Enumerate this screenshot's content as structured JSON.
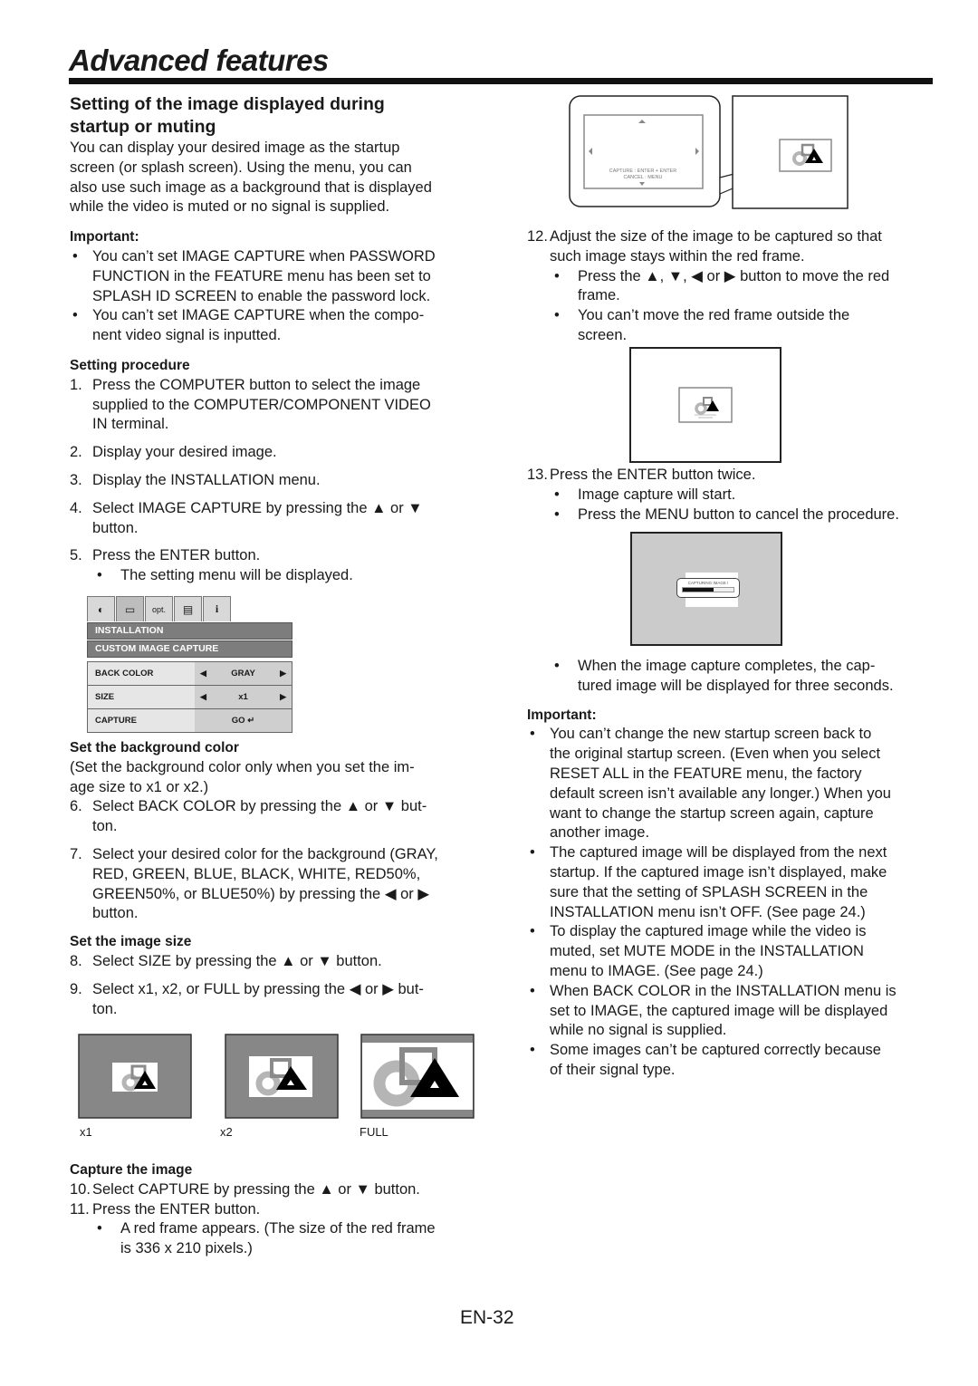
{
  "page": {
    "title": "Advanced features",
    "page_number": "EN-32"
  },
  "left": {
    "section_title_line1": "Setting of the image displayed during",
    "section_title_line2": "startup or muting",
    "intro": [
      "You can display your desired image as the startup",
      "screen (or splash screen). Using the menu, you can",
      "also use such image as a background that is displayed",
      "while the video is muted or no signal is supplied."
    ],
    "important_heading": "Important:",
    "important_bullets": [
      [
        "You can’t set IMAGE CAPTURE when PASSWORD",
        "FUNCTION in the FEATURE menu has been set to",
        "SPLASH ID SCREEN to enable the password lock."
      ],
      [
        "You can’t set IMAGE CAPTURE when the compo-",
        "nent video signal is inputted."
      ]
    ],
    "setting_procedure_heading": "Setting procedure",
    "steps_a": [
      {
        "num": "1.",
        "lines": [
          "Press the COMPUTER button to select the image",
          "supplied to the COMPUTER/COMPONENT VIDEO",
          "IN terminal."
        ]
      },
      {
        "num": "2.",
        "lines": [
          "Display your desired image."
        ]
      },
      {
        "num": "3.",
        "lines": [
          "Display the INSTALLATION menu."
        ]
      },
      {
        "num": "4.",
        "lines": [
          "Select IMAGE CAPTURE by pressing the ▲ or ▼",
          "button."
        ]
      },
      {
        "num": "5.",
        "lines": [
          "Press the ENTER button."
        ]
      }
    ],
    "step5_bullet": "The setting menu will be displayed.",
    "bg_heading": "Set the background color",
    "bg_note": [
      "(Set the background color only when you set the im-",
      "age size to x1 or x2.)"
    ],
    "steps_b": [
      {
        "num": "6.",
        "lines": [
          "Select BACK COLOR by pressing the ▲ or ▼ but-",
          "ton."
        ]
      },
      {
        "num": "7.",
        "lines": [
          "Select your desired color for the background (GRAY,",
          "RED, GREEN, BLUE, BLACK, WHITE, RED50%,",
          "GREEN50%, or BLUE50%) by pressing the ◀ or ▶",
          "button."
        ]
      }
    ],
    "size_heading": "Set the image size",
    "steps_c": [
      {
        "num": "8.",
        "lines": [
          "Select SIZE by pressing the ▲ or ▼ button."
        ]
      },
      {
        "num": "9.",
        "lines": [
          "Select x1, x2, or FULL by pressing the ◀ or ▶ but-",
          "ton."
        ]
      }
    ],
    "size_labels": [
      "x1",
      "x2",
      "FULL"
    ],
    "capture_heading": "Capture the image",
    "steps_d": [
      {
        "num": "10.",
        "lines": [
          "Select CAPTURE by pressing the ▲ or ▼ button."
        ]
      },
      {
        "num": "11.",
        "lines": [
          "Press the ENTER button."
        ]
      }
    ],
    "step11_bullet": [
      "A red frame appears. (The size of the red frame",
      "is 336 x 210 pixels.)"
    ]
  },
  "menu": {
    "tab_icons": [
      "picture-icon",
      "signal-icon",
      "options-icon",
      "installation-icon",
      "info-icon"
    ],
    "tab_text": [
      "◐",
      "▭",
      "opt.",
      "▤",
      "i"
    ],
    "header1": "INSTALLATION",
    "header2": "CUSTOM IMAGE CAPTURE",
    "rows": [
      {
        "label": "BACK COLOR",
        "value": "GRAY",
        "arrows": true
      },
      {
        "label": "SIZE",
        "value": "x1",
        "arrows": true
      },
      {
        "label": "CAPTURE",
        "value": "GO ↵",
        "arrows": false
      }
    ]
  },
  "right": {
    "callout_text1": "CAPTURE : ENTER + ENTER",
    "callout_text2": "CANCEL : MENU",
    "step12": {
      "num": "12.",
      "lines": [
        "Adjust the size of the image to be captured so that",
        "such image stays within the red frame."
      ]
    },
    "step12_bullets": [
      [
        "Press the ▲, ▼, ◀ or ▶ button to move the red",
        "frame."
      ],
      [
        "You can’t move the red frame outside the",
        "screen."
      ]
    ],
    "step13": {
      "num": "13.",
      "lines": [
        "Press the ENTER button twice."
      ]
    },
    "step13_bullets": [
      [
        "Image capture will start."
      ],
      [
        "Press the MENU button to cancel the procedure."
      ]
    ],
    "capturing_text": "CAPTURING IMAGE !",
    "capture_progress": 0.6,
    "complete_bullet": [
      "When the image capture completes, the cap-",
      "tured image will be displayed for three seconds."
    ],
    "important_heading": "Important:",
    "important_bullets": [
      [
        "You can’t change the new startup screen back to",
        "the original startup screen. (Even when you select",
        "RESET ALL in the FEATURE menu, the factory",
        "default screen isn’t available any longer.) When you",
        "want to change the startup screen again, capture",
        "another image."
      ],
      [
        "The captured image will be displayed from the next",
        "startup. If the captured image isn’t displayed, make",
        "sure that the setting of SPLASH SCREEN in the",
        "INSTALLATION menu isn’t OFF. (See page 24.)"
      ],
      [
        "To display the captured image while the video is",
        "muted, set MUTE MODE in the INSTALLATION",
        "menu to IMAGE. (See page 24.)"
      ],
      [
        "When BACK COLOR in the INSTALLATION menu is",
        "set to IMAGE, the captured image will be displayed",
        "while no signal is supplied."
      ],
      [
        "Some images can’t be captured correctly because",
        "of their signal type."
      ]
    ]
  }
}
